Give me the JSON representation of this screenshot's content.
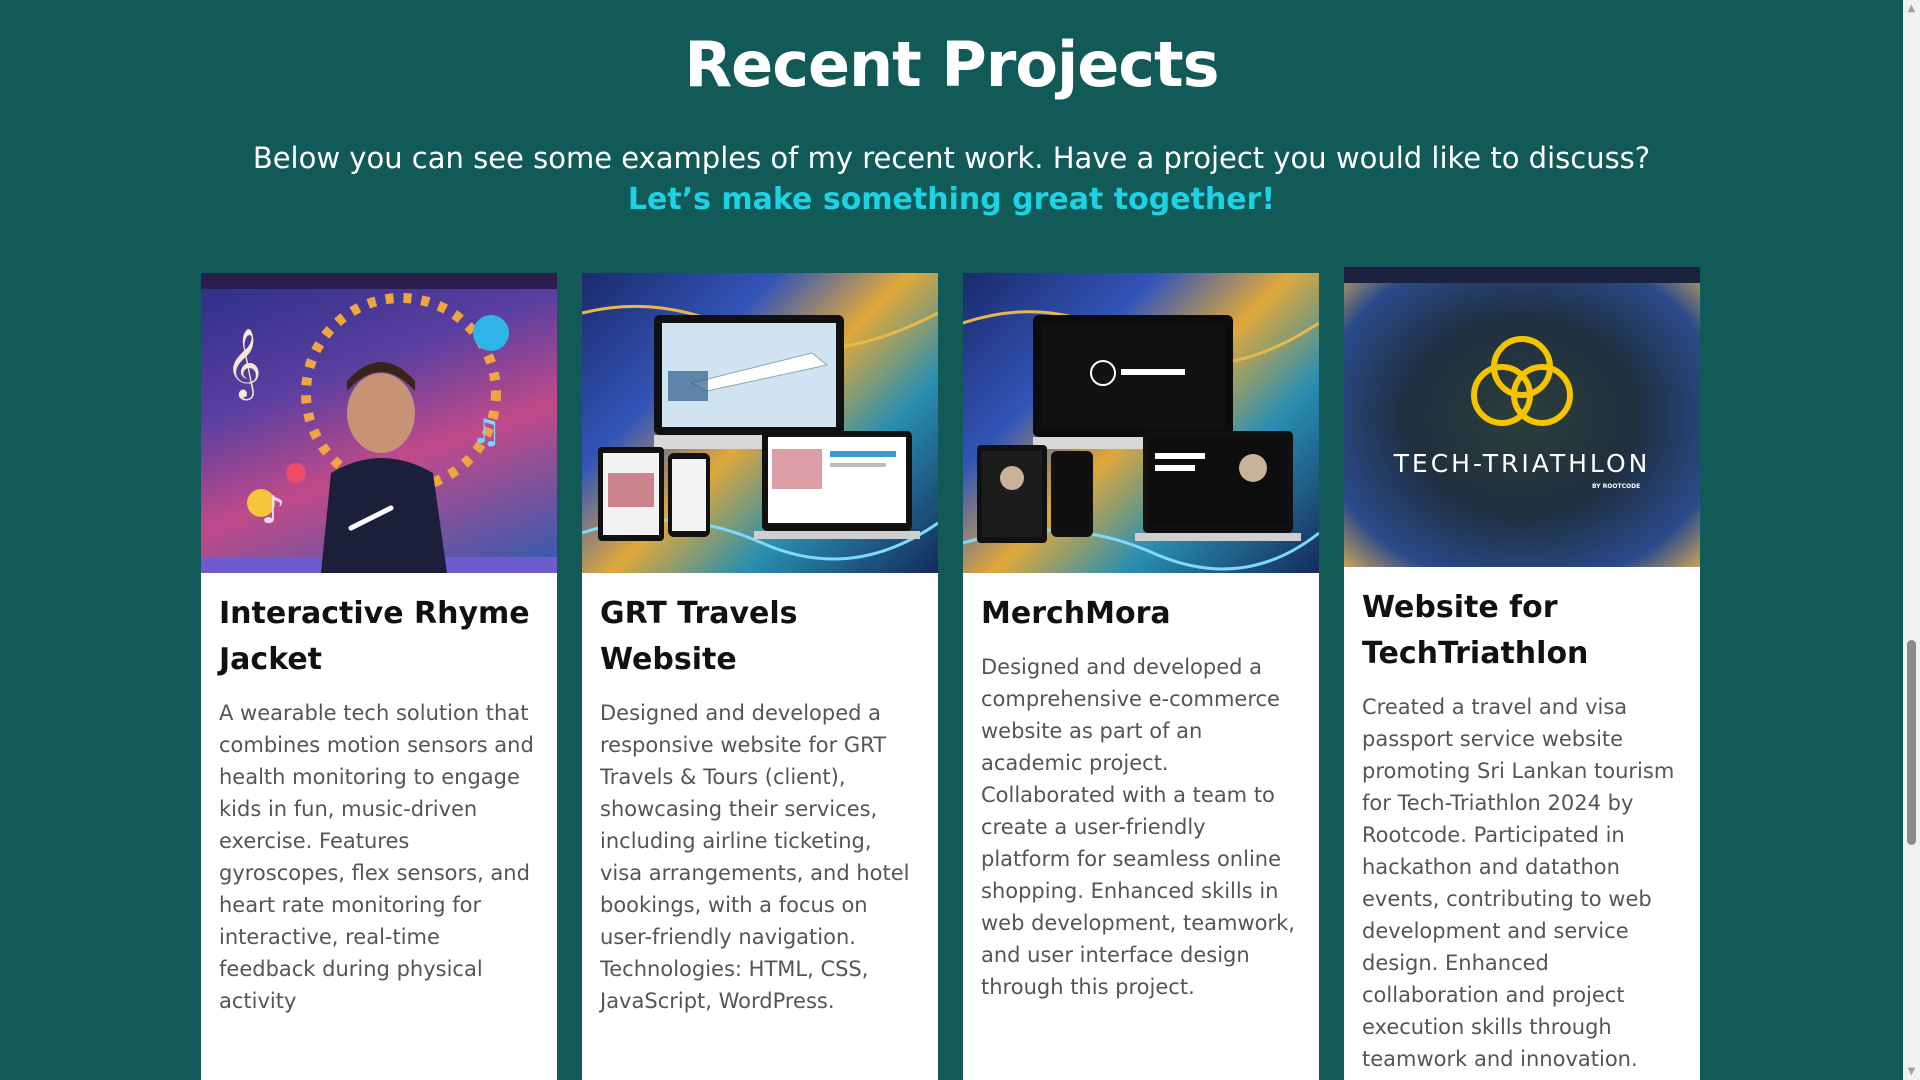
{
  "section": {
    "title": "Recent Projects",
    "subtitle": "Below you can see some examples of my recent work. Have a project you would like to discuss?",
    "cta": "Let’s make something great together!"
  },
  "colors": {
    "background": "#115a58",
    "accent": "#1cd3e6",
    "card": "#ffffff"
  },
  "projects": [
    {
      "title": "Interactive Rhyme Jacket",
      "image": "child-wearing-jacket-with-music-icons",
      "description": "A wearable tech solution that combines motion sensors and health monitoring to engage kids in fun, music-driven exercise. Features gyroscopes, flex sensors, and heart rate monitoring for interactive, real-time feedback during physical activity"
    },
    {
      "title": "GRT Travels Website",
      "image": "responsive-website-device-mockup",
      "description": "Designed and developed a responsive website for GRT Travels & Tours (client), showcasing their services, including airline ticketing, visa arrangements, and hotel bookings, with a focus on user-friendly navigation. Technologies: HTML, CSS, JavaScript, WordPress."
    },
    {
      "title": "MerchMora",
      "image": "ecommerce-website-device-mockup",
      "description": "Designed and developed a comprehensive e-commerce website as part of an academic project. Collaborated with a team to create a user-friendly platform for seamless online shopping. Enhanced skills in web development, teamwork, and user interface design through this project."
    },
    {
      "title": "Website for TechTriathlon",
      "image": "tech-triathlon-logo",
      "logo_text": "TECH-TRIATHLON",
      "logo_subtext": "BY ROOTCODE",
      "description": "Created a travel and visa passport service website promoting Sri Lankan tourism for Tech-Triathlon 2024 by Rootcode. Participated in hackathon and datathon events, contributing to web development and service design. Enhanced collaboration and project execution skills through teamwork and innovation."
    }
  ]
}
